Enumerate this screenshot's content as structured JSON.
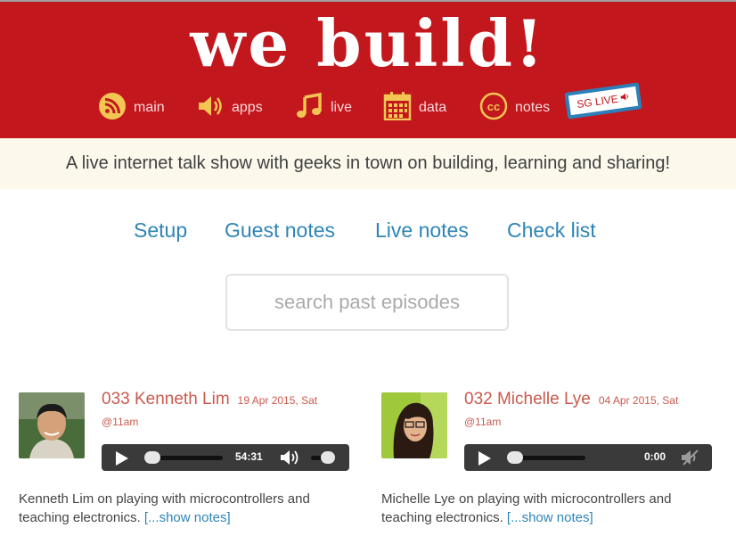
{
  "header": {
    "logo": "we build!",
    "nav": [
      {
        "label": "main",
        "icon": "rss-icon"
      },
      {
        "label": "apps",
        "icon": "speaker-icon"
      },
      {
        "label": "live",
        "icon": "music-note-icon"
      },
      {
        "label": "data",
        "icon": "calendar-icon"
      },
      {
        "label": "notes",
        "icon": "cc-icon"
      }
    ],
    "sg_live": "SG LIVE"
  },
  "tagline": "A live internet talk show with geeks in town on building, learning and sharing!",
  "links": [
    "Setup",
    "Guest notes",
    "Live notes",
    "Check list"
  ],
  "search": {
    "placeholder": "search past episodes"
  },
  "episodes": [
    {
      "title": "033 Kenneth Lim",
      "date": "19 Apr 2015, Sat",
      "time": "@11am",
      "player_time": "54:31",
      "description": "Kenneth Lim on playing with microcontrollers and teaching electronics.",
      "more": "[...show notes]"
    },
    {
      "title": "032 Michelle Lye",
      "date": "04 Apr 2015, Sat",
      "time": "@11am",
      "player_time": "0:00",
      "description": "Michelle Lye on playing with microcontrollers and teaching electronics.",
      "more": "[...show notes]"
    }
  ],
  "colors": {
    "brand_red": "#c2171d",
    "link_blue": "#2e85b6",
    "icon_gold": "#f3c552"
  }
}
